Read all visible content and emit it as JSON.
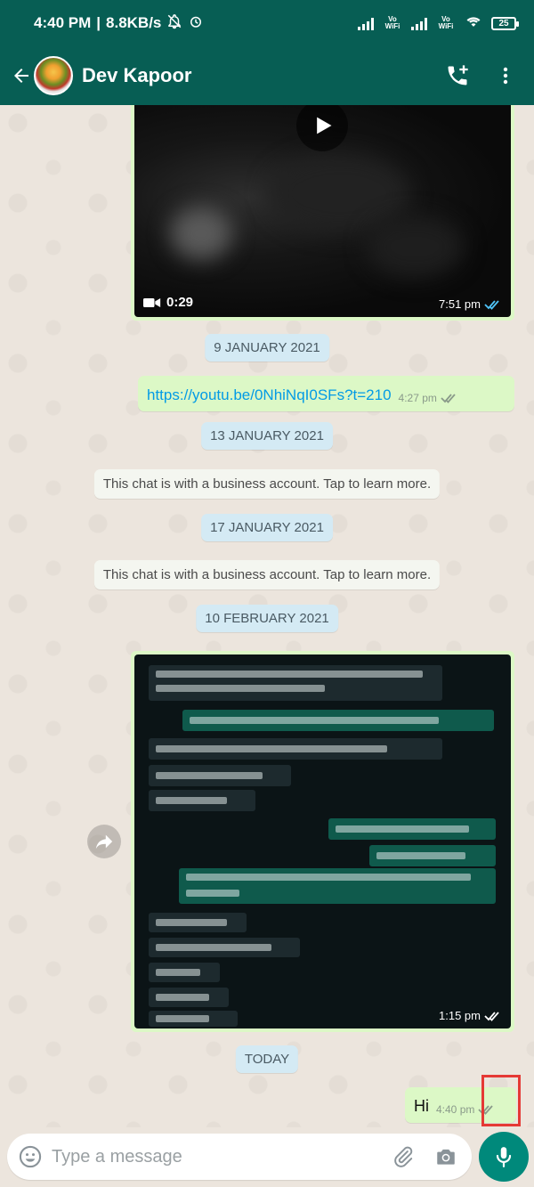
{
  "status_bar": {
    "time": "4:40 PM",
    "speed": "8.8KB/s",
    "volte_1": "Vo WiFi",
    "volte_2": "Vo WiFi",
    "battery": "25"
  },
  "header": {
    "contact_name": "Dev Kapoor"
  },
  "chat": {
    "video": {
      "duration": "0:29",
      "time": "7:51 pm",
      "ticks": "read"
    },
    "date_1": "9 JANUARY 2021",
    "link_msg": {
      "text": "https://youtu.be/0NhiNqI0SFs?t=210",
      "time": "4:27 pm",
      "ticks": "delivered"
    },
    "date_2": "13 JANUARY 2021",
    "system_1": "This chat is with a business account. Tap to learn more.",
    "date_3": "17 JANUARY 2021",
    "system_2": "This chat is with a business account. Tap to learn more.",
    "date_4": "10 FEBRUARY 2021",
    "image": {
      "time": "1:15 pm",
      "ticks": "delivered"
    },
    "date_5": "TODAY",
    "hi_msg": {
      "text": "Hi",
      "time": "4:40 pm",
      "ticks": "delivered"
    }
  },
  "input": {
    "placeholder": "Type a message"
  },
  "colors": {
    "header": "#075e54",
    "bubble_out": "#dcf8c6",
    "link": "#039be5",
    "read_tick": "#4fc3f7",
    "mic": "#00897b",
    "highlight": "#e53935"
  },
  "icons": [
    "back-arrow-icon",
    "add-call-icon",
    "more-vertical-icon",
    "play-icon",
    "video-camera-icon",
    "double-tick-icon",
    "forward-icon",
    "emoji-icon",
    "attach-icon",
    "camera-icon",
    "mic-icon"
  ]
}
